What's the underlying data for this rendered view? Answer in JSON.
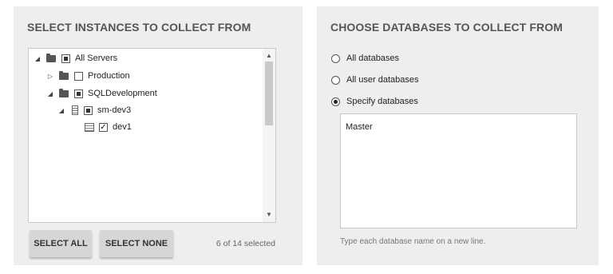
{
  "instances": {
    "title": "SELECT INSTANCES TO COLLECT FROM",
    "tree": {
      "all_servers": "All Servers",
      "production": "Production",
      "sqldevelopment": "SQLDevelopment",
      "sm_dev3": "sm-dev3",
      "dev1": "dev1"
    },
    "buttons": {
      "select_all": "SELECT ALL",
      "select_none": "SELECT NONE"
    },
    "selected_count": "6 of 14 selected"
  },
  "databases": {
    "title": "CHOOSE DATABASES TO COLLECT FROM",
    "options": {
      "all": "All databases",
      "user": "All user databases",
      "specify": "Specify databases"
    },
    "selected_option": "Specify databases",
    "textarea_value": "Master",
    "hint": "Type each database name on a new line."
  },
  "icons": {
    "expanded": "triangle-down-right-icon",
    "collapsed": "triangle-right-icon",
    "folder": "folder-icon",
    "server": "server-icon",
    "database": "database-icon",
    "scroll_up": "chevron-up-icon",
    "scroll_down": "chevron-down-icon"
  }
}
